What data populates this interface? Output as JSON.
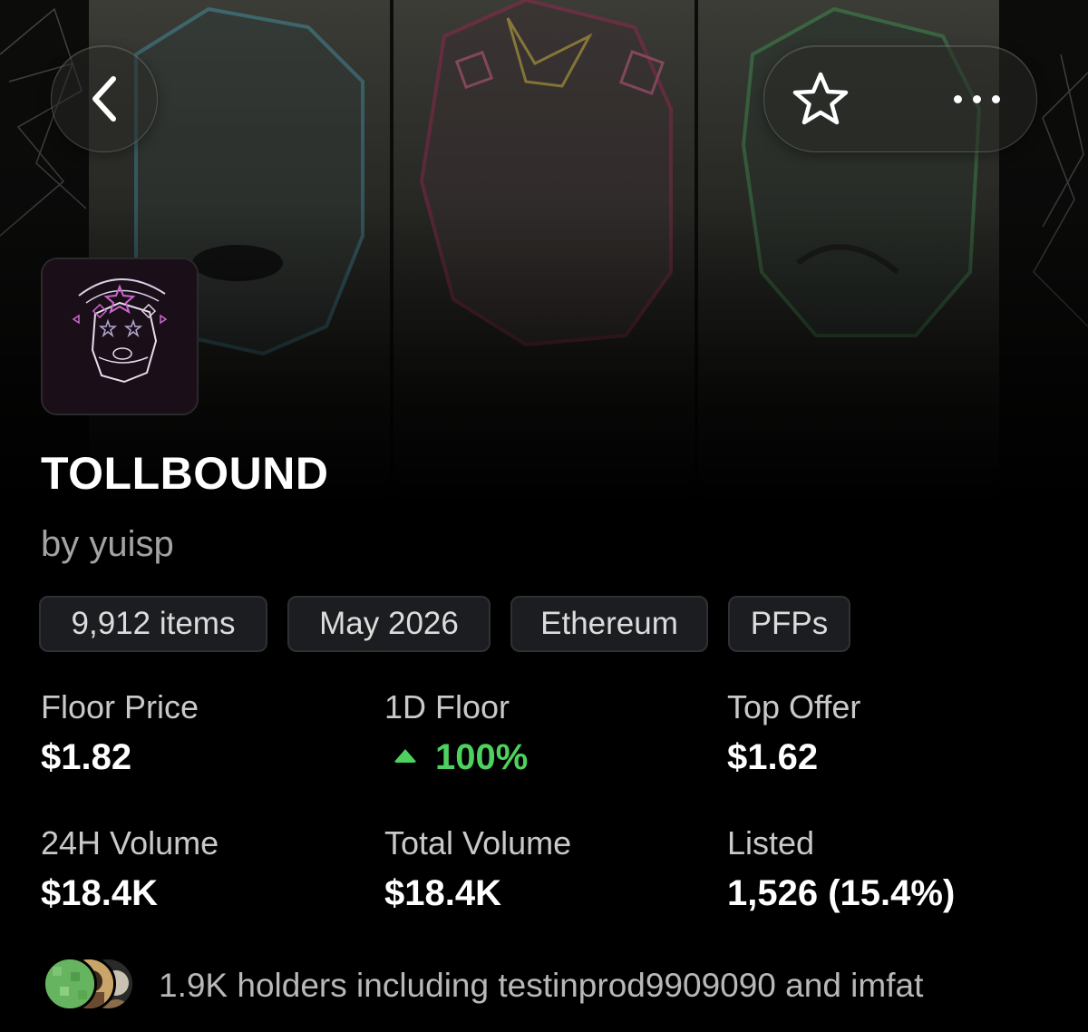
{
  "collection": {
    "name": "TOLLBOUND",
    "creator": "by yuisp"
  },
  "tags": [
    "9,912 items",
    "May 2026",
    "Ethereum",
    "PFPs"
  ],
  "stats": [
    {
      "label": "Floor Price",
      "value": "$1.82"
    },
    {
      "label": "1D Floor",
      "value": "100%",
      "trend": "up"
    },
    {
      "label": "Top Offer",
      "value": "$1.62"
    },
    {
      "label": "24H Volume",
      "value": "$18.4K"
    },
    {
      "label": "Total Volume",
      "value": "$18.4K"
    },
    {
      "label": "Listed",
      "value": "1,526 (15.4%)"
    }
  ],
  "holders": {
    "text": "1.9K holders including testinprod9909090 and imfat"
  },
  "icons": {
    "back": "chevron-left-icon",
    "favorite": "star-outline-icon",
    "more": "more-horizontal-icon",
    "trend": "triangle-up-icon"
  },
  "colors": {
    "background": "#000000",
    "positive": "#4ed25f",
    "muted_text": "#a3a3a3",
    "tag_background": "#1c1d20"
  }
}
